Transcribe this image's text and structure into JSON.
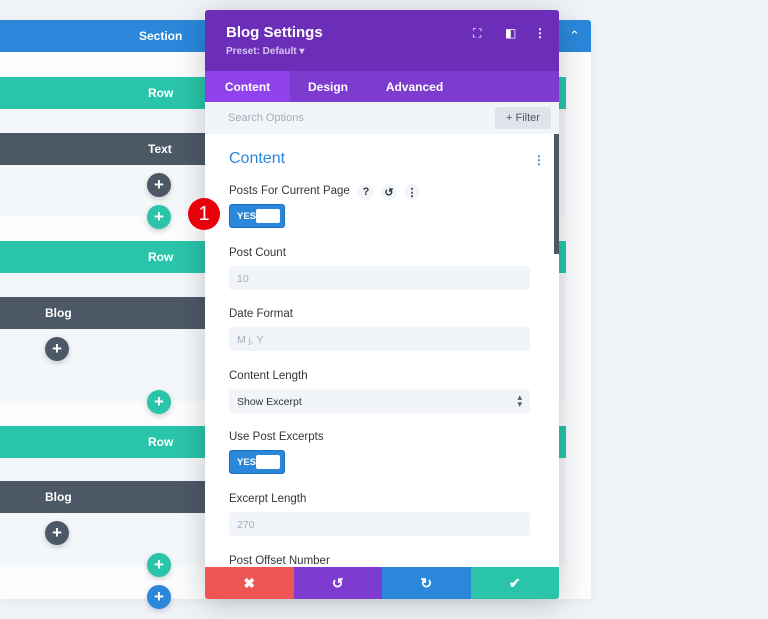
{
  "builder": {
    "section_label": "Section",
    "rows": [
      {
        "label": "Row",
        "module": "Text"
      },
      {
        "label": "Row",
        "module": "Blog"
      },
      {
        "label": "Row",
        "module": "Blog"
      }
    ],
    "add_icon": "+",
    "collapse_icon": "chevron-up"
  },
  "modal": {
    "title": "Blog Settings",
    "preset": "Preset: Default ▾",
    "header_icons": [
      "fullscreen-icon",
      "sidebar-icon",
      "more-icon"
    ],
    "tabs": [
      {
        "label": "Content",
        "active": true
      },
      {
        "label": "Design"
      },
      {
        "label": "Advanced"
      }
    ],
    "search_placeholder": "Search Options",
    "filter_label": "+ Filter",
    "group_title": "Content",
    "fields": {
      "posts_current_page": {
        "label": "Posts For Current Page",
        "value": "YES"
      },
      "post_count": {
        "label": "Post Count",
        "placeholder": "10"
      },
      "date_format": {
        "label": "Date Format",
        "placeholder": "M j, Y"
      },
      "content_length": {
        "label": "Content Length",
        "value": "Show Excerpt"
      },
      "use_post_excerpts": {
        "label": "Use Post Excerpts",
        "value": "YES"
      },
      "excerpt_length": {
        "label": "Excerpt Length",
        "placeholder": "270"
      },
      "post_offset": {
        "label": "Post Offset Number"
      }
    },
    "footer": {
      "cancel": "✖",
      "undo": "↺",
      "redo": "↻",
      "save": "✔"
    }
  },
  "annotation_badge": "1",
  "colors": {
    "purple": "#6c2eb9",
    "blue": "#2b87da",
    "green": "#29c4a9",
    "dark": "#4c5866",
    "red": "#ef5555"
  }
}
